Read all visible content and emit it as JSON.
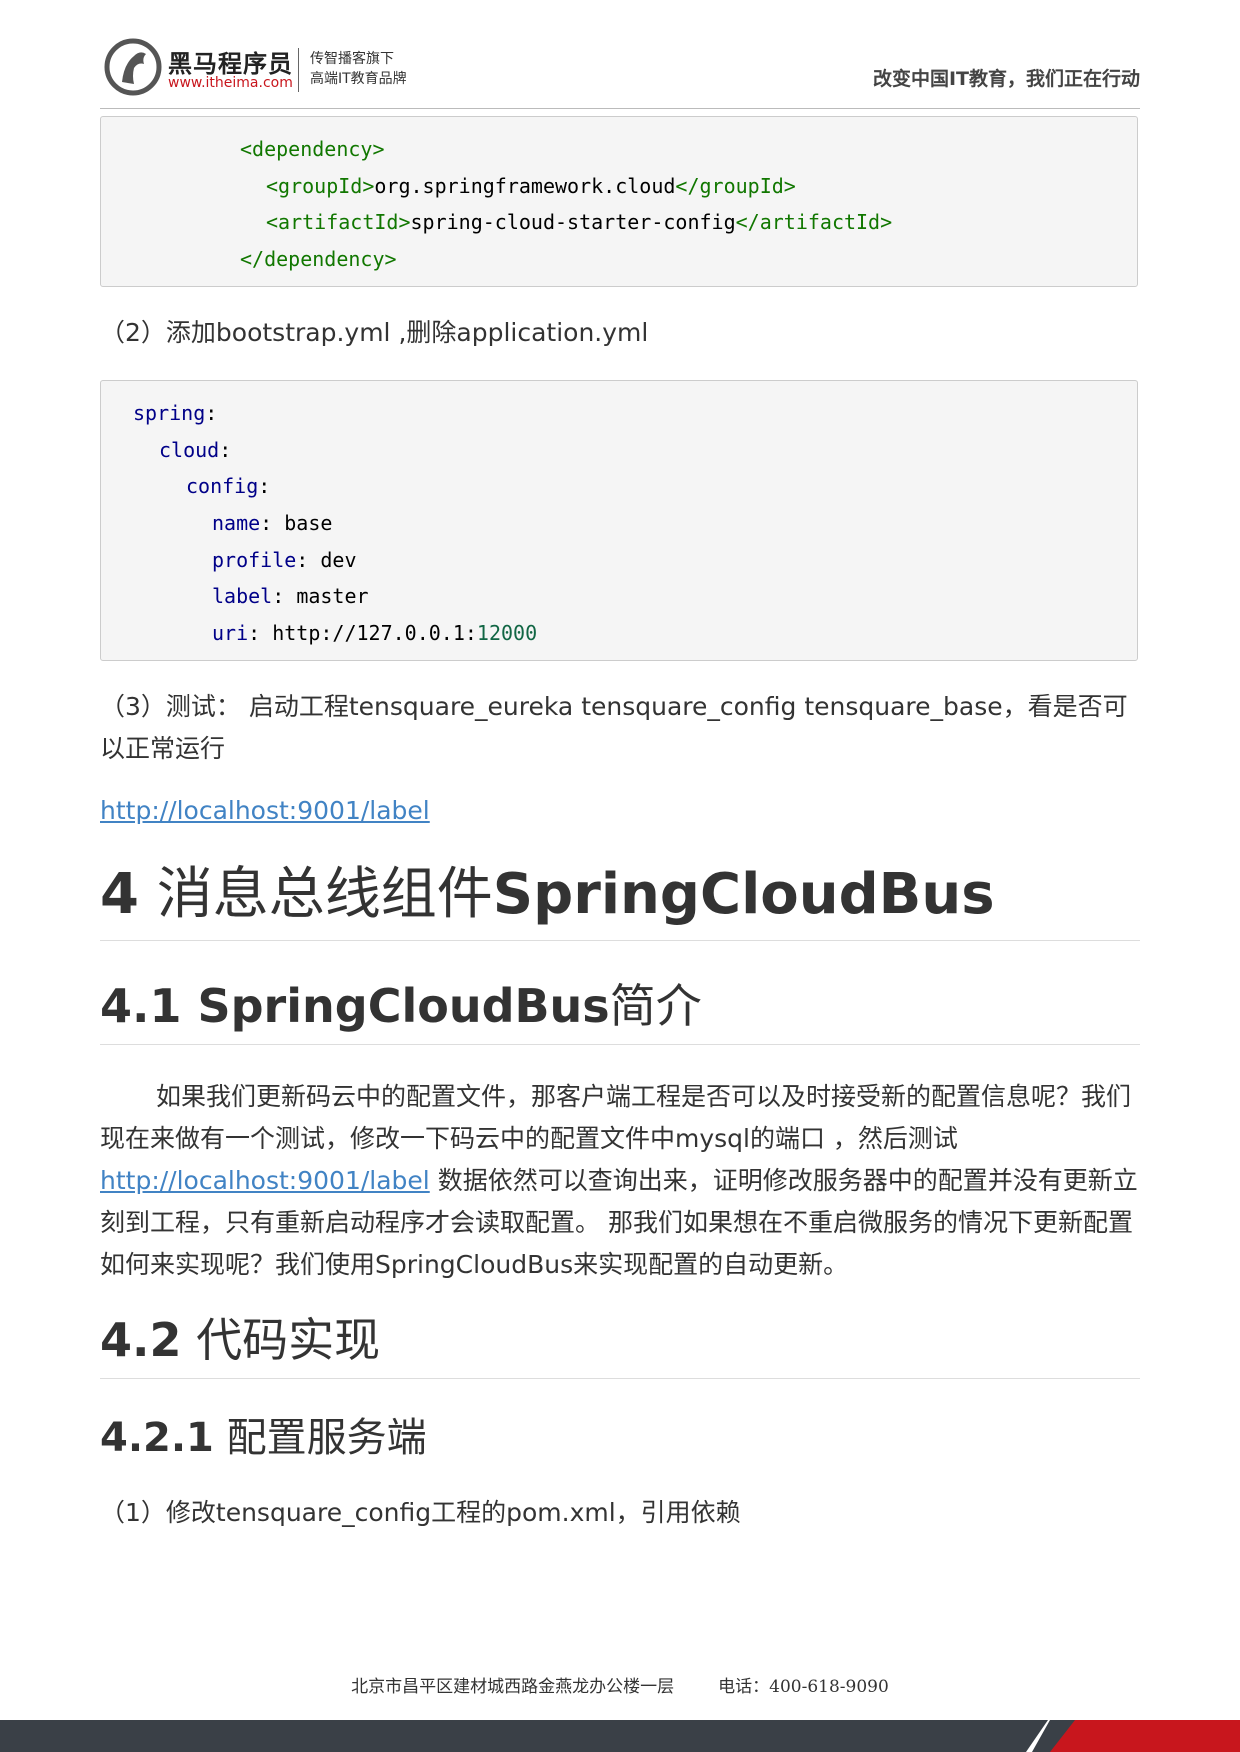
{
  "header": {
    "brand_name": "黑马程序员",
    "brand_url": "www.itheima.com",
    "brand_sub1": "传智播客旗下",
    "brand_sub2": "高端IT教育品牌",
    "slogan": "改变中国IT教育，我们正在行动"
  },
  "code1": {
    "open_tag": "<dependency>",
    "group_open": "<groupId>",
    "group_value": "org.springframework.cloud",
    "group_close": "</groupId>",
    "artifact_open": "<artifactId>",
    "artifact_value": "spring-cloud-starter-config",
    "artifact_close": "</artifactId>",
    "close_tag": "</dependency>"
  },
  "step2": "（2）添加bootstrap.yml ,删除application.yml",
  "code2": {
    "spring": "spring",
    "cloud": "cloud",
    "config": "config",
    "name_key": "name",
    "name_val": "base",
    "profile_key": "profile",
    "profile_val": "dev",
    "label_key": "label",
    "label_val": "master",
    "uri_key": "uri",
    "uri_val": "http://127.0.0.1:",
    "uri_port": "12000"
  },
  "step3": "（3）测试： 启动工程tensquare_eureka  tensquare_config  tensquare_base，看是否可以正常运行",
  "link1": "http://localhost:9001/label",
  "h1": {
    "num": "4",
    "cn": " 消息总线组件",
    "en": "SpringCloudBus"
  },
  "h2_1": {
    "bold": "4.1 SpringCloudBus",
    "rest": "简介"
  },
  "intro": {
    "part1": "如果我们更新码云中的配置文件，那客户端工程是否可以及时接受新的配置信息呢？我们现在来做有一个测试，修改一下码云中的配置文件中mysql的端口 ，然后测试",
    "link": "http://localhost:9001/label",
    "part2": " 数据依然可以查询出来，证明修改服务器中的配置并没有更新立刻到工程，只有重新启动程序才会读取配置。 那我们如果想在不重启微服务的情况下更新配置如何来实现呢？我们使用SpringCloudBus来实现配置的自动更新。"
  },
  "h2_2": {
    "bold": "4.2",
    "rest": " 代码实现"
  },
  "h3_1": {
    "bold": "4.2.1",
    "rest": " 配置服务端"
  },
  "step1": "（1）修改tensquare_config工程的pom.xml，引用依赖",
  "footer": {
    "address": "北京市昌平区建材城西路金燕龙办公楼一层",
    "phone": "电话：400-618-9090"
  }
}
